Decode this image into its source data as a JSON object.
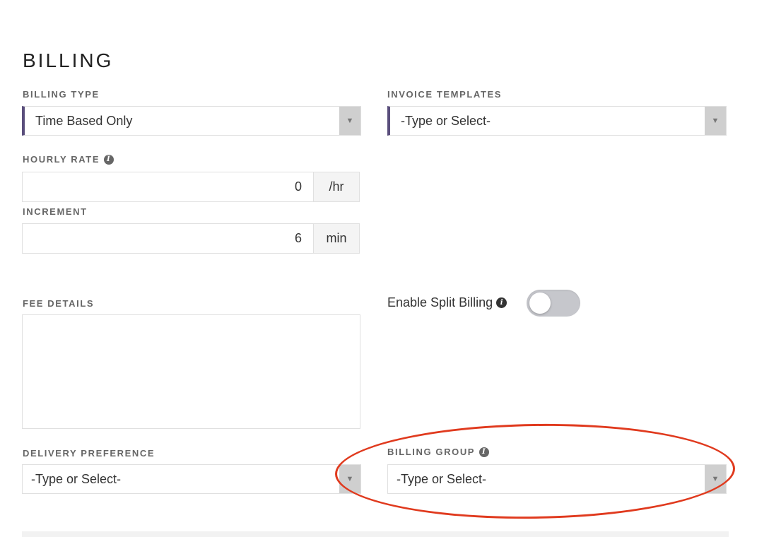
{
  "section": {
    "title": "BILLING"
  },
  "billing_type": {
    "label": "BILLING TYPE",
    "value": "Time Based Only"
  },
  "invoice_templates": {
    "label": "INVOICE TEMPLATES",
    "value": "-Type or Select-"
  },
  "hourly_rate": {
    "label": "HOURLY RATE",
    "value": "0",
    "unit": "/hr"
  },
  "increment": {
    "label": "INCREMENT",
    "value": "6",
    "unit": "min"
  },
  "fee_details": {
    "label": "FEE DETAILS",
    "value": ""
  },
  "split_billing": {
    "label": "Enable Split Billing",
    "enabled": false
  },
  "delivery_preference": {
    "label": "DELIVERY PREFERENCE",
    "value": "-Type or Select-"
  },
  "billing_group": {
    "label": "BILLING GROUP",
    "value": "-Type or Select-"
  },
  "icons": {
    "info": "info-icon",
    "dropdown": "caret-down-icon"
  },
  "colors": {
    "accent": "#5a4e7c",
    "annotation": "#e03a1e",
    "toggle_off": "#c6c7cc"
  }
}
